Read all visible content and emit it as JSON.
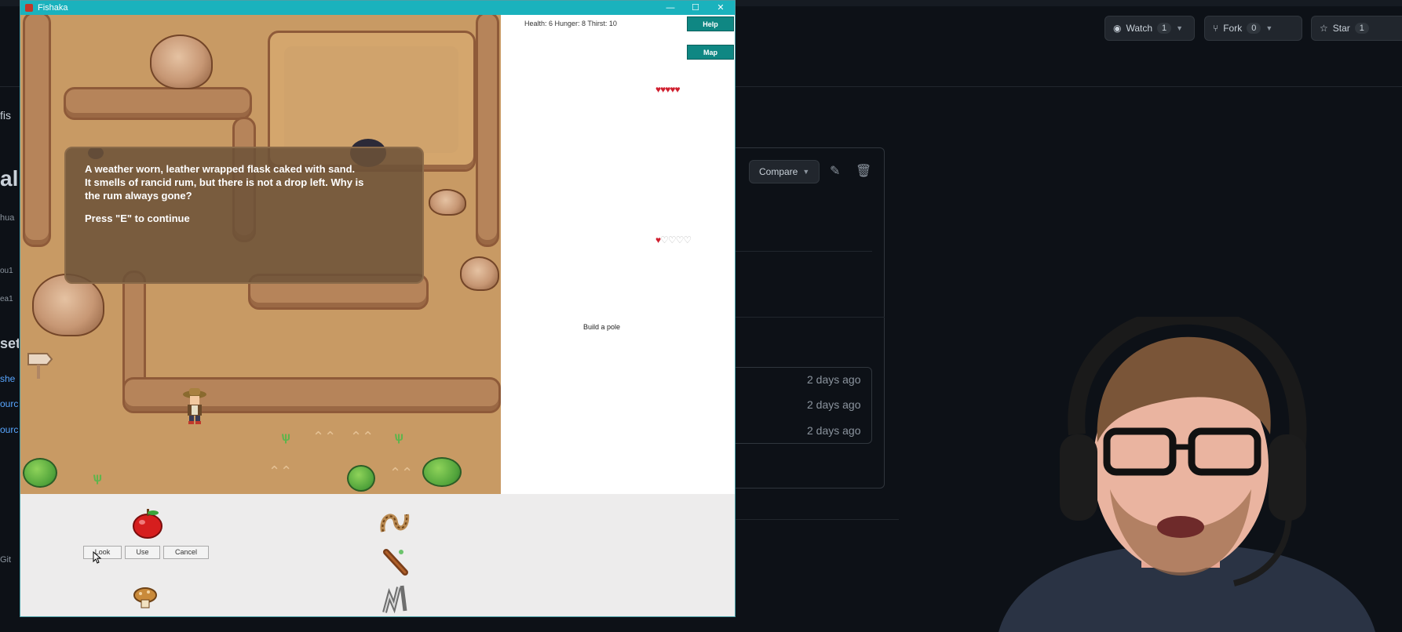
{
  "window": {
    "title": "Fishaka",
    "controls": {
      "minimize": "—",
      "maximize": "☐",
      "close": "✕"
    }
  },
  "stats": {
    "text": "Health: 6   Hunger: 8   Thirst: 10"
  },
  "buttons": {
    "help": "Help",
    "map": "Map"
  },
  "hearts": {
    "row1": {
      "full": 5,
      "total": 5
    },
    "row2": {
      "full": 1,
      "total": 5
    }
  },
  "dialog": {
    "message": "A weather worn, leather wrapped flask caked with sand.\nIt smells of rancid rum, but there is not a drop left. Why is\nthe rum always gone?",
    "prompt": "Press \"E\" to continue"
  },
  "quest": {
    "text": "Build a pole"
  },
  "inventory": {
    "actions": {
      "look": "Look",
      "use": "Use",
      "cancel": "Cancel"
    },
    "items": [
      "apple-icon",
      "mushroom-icon",
      "rope-icon",
      "stick-icon",
      "hook-icon"
    ]
  },
  "github": {
    "watch": {
      "label": "Watch",
      "count": "1"
    },
    "fork": {
      "label": "Fork",
      "count": "0"
    },
    "star": {
      "label": "Star",
      "count": "1"
    },
    "compare": "Compare",
    "file_ages": [
      "2 days ago",
      "2 days ago",
      "2 days ago"
    ],
    "left_fragments": {
      "repo": "fis",
      "heading": "al",
      "user": "hua",
      "meta1": "ou1",
      "meta2": "ea1",
      "section": "sets",
      "link1": "she",
      "link2": "ourc",
      "link3": "ourc",
      "footer": "Git"
    }
  },
  "colors": {
    "titlebar": "#1ab2bd",
    "sand": "#c89a64",
    "dialog_bg": "#6c5238",
    "side_button": "#0f8783",
    "heart": "#d01f2f",
    "github_bg": "#0d1117"
  }
}
